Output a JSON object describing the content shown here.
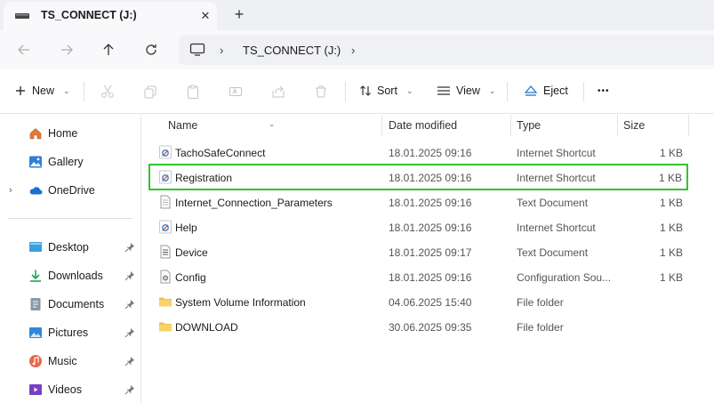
{
  "window": {
    "tab_title": "TS_CONNECT (J:)",
    "tab_close": "✕",
    "tab_add": "+"
  },
  "address": {
    "crumbs": [
      "TS_CONNECT (J:)"
    ],
    "sep": "›"
  },
  "commands": {
    "new": "New",
    "sort": "Sort",
    "view": "View",
    "eject": "Eject",
    "more": "•••"
  },
  "sidebar": {
    "items": [
      {
        "label": "Home",
        "icon": "home-icon"
      },
      {
        "label": "Gallery",
        "icon": "gallery-icon"
      },
      {
        "label": "OneDrive",
        "icon": "onedrive-icon"
      },
      {
        "label": "Desktop",
        "icon": "desktop-icon",
        "pinned": true
      },
      {
        "label": "Downloads",
        "icon": "downloads-icon",
        "pinned": true
      },
      {
        "label": "Documents",
        "icon": "documents-icon",
        "pinned": true
      },
      {
        "label": "Pictures",
        "icon": "pictures-icon",
        "pinned": true
      },
      {
        "label": "Music",
        "icon": "music-icon",
        "pinned": true
      },
      {
        "label": "Videos",
        "icon": "videos-icon",
        "pinned": true
      }
    ]
  },
  "columns": {
    "name": "Name",
    "date": "Date modified",
    "type": "Type",
    "size": "Size"
  },
  "files": [
    {
      "name": "TachoSafeConnect",
      "date": "18.01.2025 09:16",
      "type": "Internet Shortcut",
      "size": "1 KB",
      "icon": "internet-shortcut-icon"
    },
    {
      "name": "Registration",
      "date": "18.01.2025 09:16",
      "type": "Internet Shortcut",
      "size": "1 KB",
      "icon": "internet-shortcut-icon"
    },
    {
      "name": "Internet_Connection_Parameters",
      "date": "18.01.2025 09:16",
      "type": "Text Document",
      "size": "1 KB",
      "icon": "text-document-icon"
    },
    {
      "name": "Help",
      "date": "18.01.2025 09:16",
      "type": "Internet Shortcut",
      "size": "1 KB",
      "icon": "internet-shortcut-icon"
    },
    {
      "name": "Device",
      "date": "18.01.2025 09:17",
      "type": "Text Document",
      "size": "1 KB",
      "icon": "text-document-icon"
    },
    {
      "name": "Config",
      "date": "18.01.2025 09:16",
      "type": "Configuration Sou...",
      "size": "1 KB",
      "icon": "config-file-icon"
    },
    {
      "name": "System Volume Information",
      "date": "04.06.2025 15:40",
      "type": "File folder",
      "size": "",
      "icon": "folder-icon"
    },
    {
      "name": "DOWNLOAD",
      "date": "30.06.2025 09:35",
      "type": "File folder",
      "size": "",
      "icon": "folder-icon"
    }
  ],
  "colors": {
    "selection_outline": "#35c22e",
    "accent": "#1a73c8"
  }
}
